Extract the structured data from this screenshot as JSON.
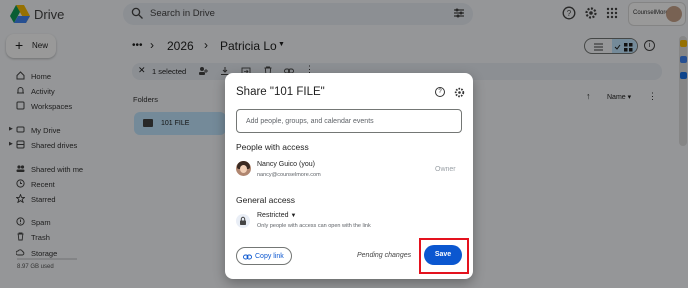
{
  "app": {
    "name": "Drive"
  },
  "search": {
    "placeholder": "Search in Drive"
  },
  "account": {
    "logo_text": "CounselMore"
  },
  "new_button": {
    "label": "New"
  },
  "sidebar": {
    "items": [
      {
        "label": "Home",
        "icon": "home-icon"
      },
      {
        "label": "Activity",
        "icon": "bell-icon"
      },
      {
        "label": "Workspaces",
        "icon": "workspaces-icon"
      },
      {
        "label": "My Drive",
        "icon": "drive-icon"
      },
      {
        "label": "Shared drives",
        "icon": "shared-drives-icon"
      },
      {
        "label": "Shared with me",
        "icon": "people-icon"
      },
      {
        "label": "Recent",
        "icon": "clock-icon"
      },
      {
        "label": "Starred",
        "icon": "star-icon"
      },
      {
        "label": "Spam",
        "icon": "spam-icon"
      },
      {
        "label": "Trash",
        "icon": "trash-icon"
      },
      {
        "label": "Storage",
        "icon": "cloud-icon"
      }
    ],
    "storage_used": "8.97 GB used"
  },
  "breadcrumb": {
    "more": "•••",
    "items": [
      "2026",
      "Patricia Lo"
    ]
  },
  "selection_bar": {
    "count_label": "1 selected"
  },
  "main": {
    "section_label": "Folders",
    "sort_label": "Name",
    "folders": [
      {
        "name": "101 FILE"
      }
    ]
  },
  "dialog": {
    "title": "Share \"101 FILE\"",
    "input_placeholder": "Add people, groups, and calendar events",
    "people_heading": "People with access",
    "person": {
      "name": "Nancy Guico (you)",
      "email": "nancy@counselmore.com",
      "role": "Owner"
    },
    "general_heading": "General access",
    "access_level": "Restricted",
    "access_description": "Only people with access can open with the link",
    "copy_link_label": "Copy link",
    "pending_label": "Pending changes",
    "save_label": "Save"
  },
  "colors": {
    "accent": "#0b57d0",
    "highlight": "#e4121e",
    "selected_folder": "#c2e7ff"
  }
}
